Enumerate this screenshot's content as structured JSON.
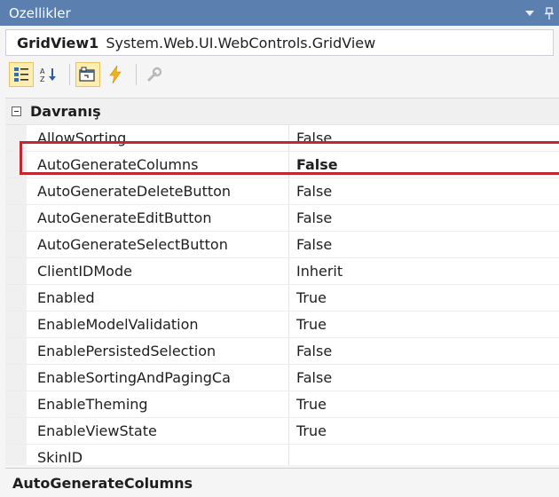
{
  "window": {
    "title": "Ozellikler"
  },
  "object_selector": {
    "name": "GridView1",
    "type": "System.Web.UI.WebControls.GridView"
  },
  "toolbar": {
    "buttons": [
      {
        "icon": "categorized-icon",
        "active": true
      },
      {
        "icon": "alphabetical-sort-icon",
        "active": false
      },
      {
        "icon": "properties-icon",
        "active": true
      },
      {
        "icon": "events-lightning-icon",
        "active": false
      },
      {
        "icon": "property-pages-wrench-icon",
        "active": false
      }
    ]
  },
  "category": {
    "label": "Davranış",
    "expanded": true
  },
  "properties": [
    {
      "name": "AllowSorting",
      "value": "False"
    },
    {
      "name": "AutoGenerateColumns",
      "value": "False",
      "bold": true,
      "highlighted": true
    },
    {
      "name": "AutoGenerateDeleteButton",
      "value": "False"
    },
    {
      "name": "AutoGenerateEditButton",
      "value": "False"
    },
    {
      "name": "AutoGenerateSelectButton",
      "value": "False"
    },
    {
      "name": "ClientIDMode",
      "value": "Inherit"
    },
    {
      "name": "Enabled",
      "value": "True"
    },
    {
      "name": "EnableModelValidation",
      "value": "True"
    },
    {
      "name": "EnablePersistedSelection",
      "value": "False"
    },
    {
      "name": "EnableSortingAndPagingCa",
      "value": "False"
    },
    {
      "name": "EnableTheming",
      "value": "True"
    },
    {
      "name": "EnableViewState",
      "value": "True"
    },
    {
      "name": "SkinID",
      "value": ""
    }
  ],
  "description": {
    "title": "AutoGenerateColumns"
  },
  "colors": {
    "titlebar": "#5b7fae",
    "highlight_border": "#c3262e",
    "active_tool": "#fcedb1"
  }
}
